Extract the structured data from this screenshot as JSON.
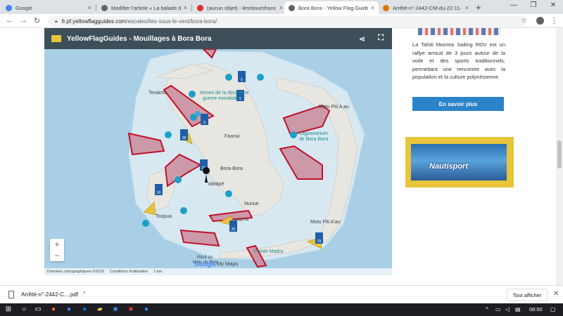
{
  "browser": {
    "tabs": [
      {
        "label": "Google",
        "color": "#4285f4",
        "active": false
      },
      {
        "label": "Modifier l'article « La balade d",
        "color": "#5f6368",
        "active": false
      },
      {
        "label": "(aucun objet) - lereboursfranc",
        "color": "#d93025",
        "active": false
      },
      {
        "label": "Bora Bora - Yellow Flag Guide",
        "color": "#5f6368",
        "active": true
      },
      {
        "label": "Arrêté-n°-2442-CM-du-22-11-",
        "color": "#e37400",
        "active": false
      }
    ],
    "new_tab": "+",
    "url_host": "fr.pf.yellowflagguides.com",
    "url_path": "/escales/iles-sous-le-vent/bora-bora/"
  },
  "map": {
    "title": "YellowFlagGuides - Mouillages à Bora Bora",
    "labels": {
      "tevairoa": "Tevairoa",
      "armes": "Armes de la deuxième",
      "armes2": "guerre mondiale",
      "faanui": "Faanui",
      "motu_piti_a_au_n": "Motu Piti A au",
      "lagoonarium": "Lagoonarium",
      "lagoonarium2": "de Bora Bora",
      "bora_bora": "Bora-Bora",
      "vaitape": "Vaitāpē",
      "nunue": "Nunue",
      "toopua": "Toopua",
      "motu_piti_aau_s": "Motu Piti A'au",
      "pointe_matira": "Pointe Matira",
      "recif": "Récif du",
      "recif2": "Motu de Bora",
      "laguna": "Laguna"
    },
    "markers": [
      "5",
      "5",
      "28",
      "20",
      "20",
      "20",
      "29",
      "5"
    ],
    "footer": [
      "Données cartographiques ©2019",
      "Conditions d'utilisation",
      "1 km"
    ],
    "google": "Google",
    "mymaps": "My Maps",
    "zoom_in": "+",
    "zoom_out": "−"
  },
  "sidebar": {
    "text": "La Tahiti Moorea Sailing RDV est un rallye amical de 3 jours autour de la voile et des sports traditionnels, permettant une rencontre avec la population et la culture polynésienne.",
    "cta": "En savoir plus",
    "ad": "Nautisport"
  },
  "downloads": {
    "file": "Arrêté-n°-2442-C....pdf",
    "show_all": "Tout afficher"
  },
  "taskbar": {
    "time": "08:50"
  },
  "colors": {
    "water": "#a8cfe6",
    "land": "#e8e6e1",
    "zone": "#c98b9b",
    "zone_stroke": "#c0122c",
    "anchor": "#1f5fa8",
    "yellow": "#e8c53a"
  }
}
